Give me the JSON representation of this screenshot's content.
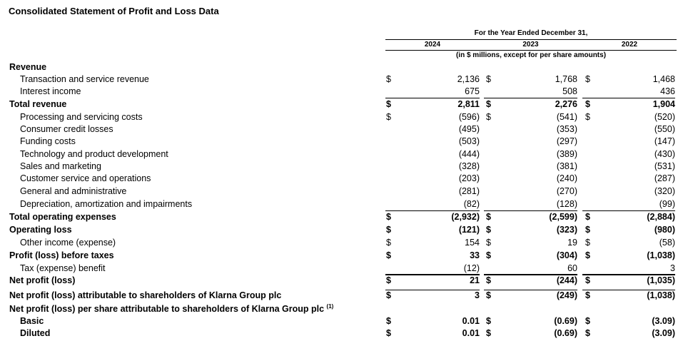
{
  "title": "Consolidated Statement of Profit and Loss Data",
  "header": {
    "period": "For the Year Ended December 31,",
    "years": [
      "2024",
      "2023",
      "2022"
    ],
    "units": "(in $ millions, except for per share amounts)"
  },
  "rows": [
    {
      "label": "Revenue",
      "bold": true,
      "indent": 0,
      "sym": false,
      "values": [
        "",
        "",
        ""
      ]
    },
    {
      "label": "Transaction and service revenue",
      "bold": false,
      "indent": 1,
      "sym": true,
      "values": [
        "2,136",
        "1,768",
        "1,468"
      ]
    },
    {
      "label": "Interest income",
      "bold": false,
      "indent": 1,
      "sym": false,
      "values": [
        "675",
        "508",
        "436"
      ]
    },
    {
      "label": "Total revenue",
      "bold": true,
      "indent": 0,
      "sym": true,
      "values": [
        "2,811",
        "2,276",
        "1,904"
      ]
    },
    {
      "label": "Processing and servicing costs",
      "bold": false,
      "indent": 1,
      "sym": true,
      "values": [
        "(596)",
        "(541)",
        "(520)"
      ]
    },
    {
      "label": "Consumer credit losses",
      "bold": false,
      "indent": 1,
      "sym": false,
      "values": [
        "(495)",
        "(353)",
        "(550)"
      ]
    },
    {
      "label": "Funding costs",
      "bold": false,
      "indent": 1,
      "sym": false,
      "values": [
        "(503)",
        "(297)",
        "(147)"
      ]
    },
    {
      "label": "Technology and product development",
      "bold": false,
      "indent": 1,
      "sym": false,
      "values": [
        "(444)",
        "(389)",
        "(430)"
      ]
    },
    {
      "label": "Sales and marketing",
      "bold": false,
      "indent": 1,
      "sym": false,
      "values": [
        "(328)",
        "(381)",
        "(531)"
      ]
    },
    {
      "label": "Customer service and operations",
      "bold": false,
      "indent": 1,
      "sym": false,
      "values": [
        "(203)",
        "(240)",
        "(287)"
      ]
    },
    {
      "label": "General and administrative",
      "bold": false,
      "indent": 1,
      "sym": false,
      "values": [
        "(281)",
        "(270)",
        "(320)"
      ]
    },
    {
      "label": "Depreciation, amortization and impairments",
      "bold": false,
      "indent": 1,
      "sym": false,
      "values": [
        "(82)",
        "(128)",
        "(99)"
      ]
    },
    {
      "label": "Total operating expenses",
      "bold": true,
      "indent": 0,
      "sym": true,
      "values": [
        "(2,932)",
        "(2,599)",
        "(2,884)"
      ]
    },
    {
      "label": "Operating loss",
      "bold": true,
      "indent": 0,
      "sym": true,
      "values": [
        "(121)",
        "(323)",
        "(980)"
      ]
    },
    {
      "label": "Other income (expense)",
      "bold": false,
      "indent": 1,
      "sym": true,
      "values": [
        "154",
        "19",
        "(58)"
      ]
    },
    {
      "label": "Profit (loss) before taxes",
      "bold": true,
      "indent": 0,
      "sym": true,
      "values": [
        "33",
        "(304)",
        "(1,038)"
      ]
    },
    {
      "label": "Tax (expense) benefit",
      "bold": false,
      "indent": 1,
      "sym": false,
      "values": [
        "(12)",
        "60",
        "3"
      ]
    },
    {
      "label": "Net profit (loss)",
      "bold": true,
      "indent": 0,
      "sym": true,
      "values": [
        "21",
        "(244)",
        "(1,035)"
      ]
    },
    {
      "label": "Net profit (loss) attributable to shareholders of Klarna Group plc",
      "bold": true,
      "indent": 0,
      "sym": true,
      "values": [
        "3",
        "(249)",
        "(1,038)"
      ]
    },
    {
      "label": "Net profit (loss) per share attributable to shareholders of Klarna Group plc",
      "footnote": "(1)",
      "bold": true,
      "indent": 0,
      "sym": false,
      "values": [
        "",
        "",
        ""
      ]
    },
    {
      "label": "Basic",
      "bold": true,
      "indent": 1,
      "sym": true,
      "values": [
        "0.01",
        "(0.69)",
        "(3.09)"
      ]
    },
    {
      "label": "Diluted",
      "bold": true,
      "indent": 1,
      "sym": true,
      "values": [
        "0.01",
        "(0.69)",
        "(3.09)"
      ]
    }
  ],
  "currency_symbol": "$",
  "colors": {
    "row_shade": "#d4ecfb",
    "text": "#000000"
  }
}
